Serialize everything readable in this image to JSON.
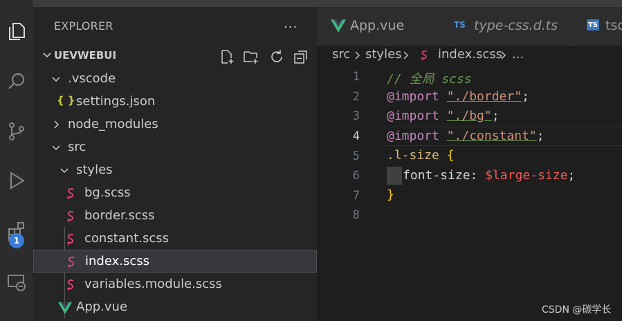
{
  "explorer": {
    "title": "EXPLORER",
    "more": "...",
    "project": "UEVWEBUI",
    "tree": [
      {
        "label": ".vscode"
      },
      {
        "label": "settings.json",
        "icon": "{ }"
      },
      {
        "label": "node_modules"
      },
      {
        "label": "src"
      },
      {
        "label": "styles"
      },
      {
        "label": "bg.scss"
      },
      {
        "label": "border.scss"
      },
      {
        "label": "constant.scss"
      },
      {
        "label": "index.scss"
      },
      {
        "label": "variables.module.scss"
      },
      {
        "label": "App.vue"
      }
    ]
  },
  "activity": {
    "extensions_badge": "1"
  },
  "tabs": [
    {
      "label": "App.vue",
      "icon": "vue-icon"
    },
    {
      "label": "type-css.d.ts",
      "badge": "TS"
    },
    {
      "label": "tsc",
      "badge": "TS"
    }
  ],
  "breadcrumb": {
    "a": "src",
    "b": "styles",
    "c": "index.scss",
    "d": "..."
  },
  "editor": {
    "line_numbers": [
      "1",
      "2",
      "3",
      "4",
      "5",
      "6",
      "7",
      "8"
    ],
    "lines": {
      "l1": "// 全局 scss",
      "kw": "@import",
      "s2": "\"./border\"",
      "s3": "\"./bg\"",
      "s4": "\"./constant\"",
      "semi": ";",
      "sel": ".l-size",
      "open": "{",
      "prop": "font-size: ",
      "var": "$large-size",
      "close": "}"
    }
  },
  "watermark": "CSDN @碳学长",
  "colors": {
    "accent": "#3a7bd5",
    "scss_icon": "#e8467c",
    "vue_green": "#41b883"
  }
}
